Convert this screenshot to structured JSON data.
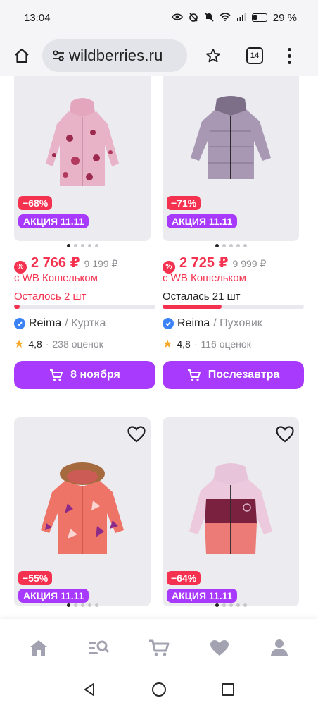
{
  "status_bar": {
    "time": "13:04",
    "battery": "29 %"
  },
  "browser": {
    "url": "wildberries.ru",
    "tab_count": "14"
  },
  "products": [
    {
      "discount": "−68%",
      "promo": "АКЦИЯ 11.11",
      "price": "2 766 ₽",
      "old_price": "9 199 ₽",
      "wallet": "с WB Кошельком",
      "stock": "Осталось 2 шт",
      "stock_level": 0.04,
      "brand": "Reima",
      "category": "/ Куртка",
      "rating": "4,8",
      "reviews": "238 оценок",
      "delivery": "8 ноября",
      "image_icon": "pink-floral-jacket"
    },
    {
      "discount": "−71%",
      "promo": "АКЦИЯ 11.11",
      "price": "2 725 ₽",
      "old_price": "9 999 ₽",
      "wallet": "с WB Кошельком",
      "stock": "Осталась 21 шт",
      "stock_level": 0.42,
      "brand": "Reima",
      "category": "/ Пуховик",
      "rating": "4,8",
      "reviews": "116 оценок",
      "delivery": "Послезавтра",
      "image_icon": "lilac-puffer-jacket"
    },
    {
      "discount": "−55%",
      "promo": "АКЦИЯ 11.11",
      "image_icon": "coral-fur-hood-jacket"
    },
    {
      "discount": "−64%",
      "promo": "АКЦИЯ 11.11",
      "image_icon": "pink-coral-ski-jacket"
    }
  ],
  "colors": {
    "accent": "#a73afd",
    "sale": "#f4314f",
    "card_bg": "#ebebf0"
  },
  "bottom_nav": [
    "home-icon",
    "catalog-search-icon",
    "cart-icon",
    "favorites-icon",
    "profile-icon"
  ],
  "system_nav": [
    "back-icon",
    "home-circle-icon",
    "recents-icon"
  ]
}
